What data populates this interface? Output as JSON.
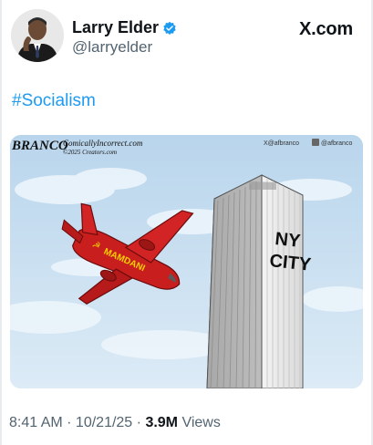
{
  "post": {
    "author": {
      "display_name": "Larry Elder",
      "handle": "@larryelder",
      "verified": true,
      "avatar_icon": "avatar-photo"
    },
    "site_label": "X.com",
    "text": "#Socialism",
    "cartoon": {
      "brand": "BRANCO",
      "site": "ComicallyIncorrect.com",
      "copyright": "©2025 Creators.com",
      "social_x": "X@afbranco",
      "social_t": "@afbranco",
      "plane_text": "MAMDANI",
      "tower_text_1": "NY",
      "tower_text_2": "CITY"
    },
    "timestamp": "8:41 AM · 10/21/25 ·",
    "views_count": "3.9M",
    "views_label": "Views"
  },
  "colors": {
    "link": "#1d9bf0",
    "verified": "#1d9bf0",
    "plane_red": "#c81e1e",
    "sky": "#cfe3f2"
  }
}
